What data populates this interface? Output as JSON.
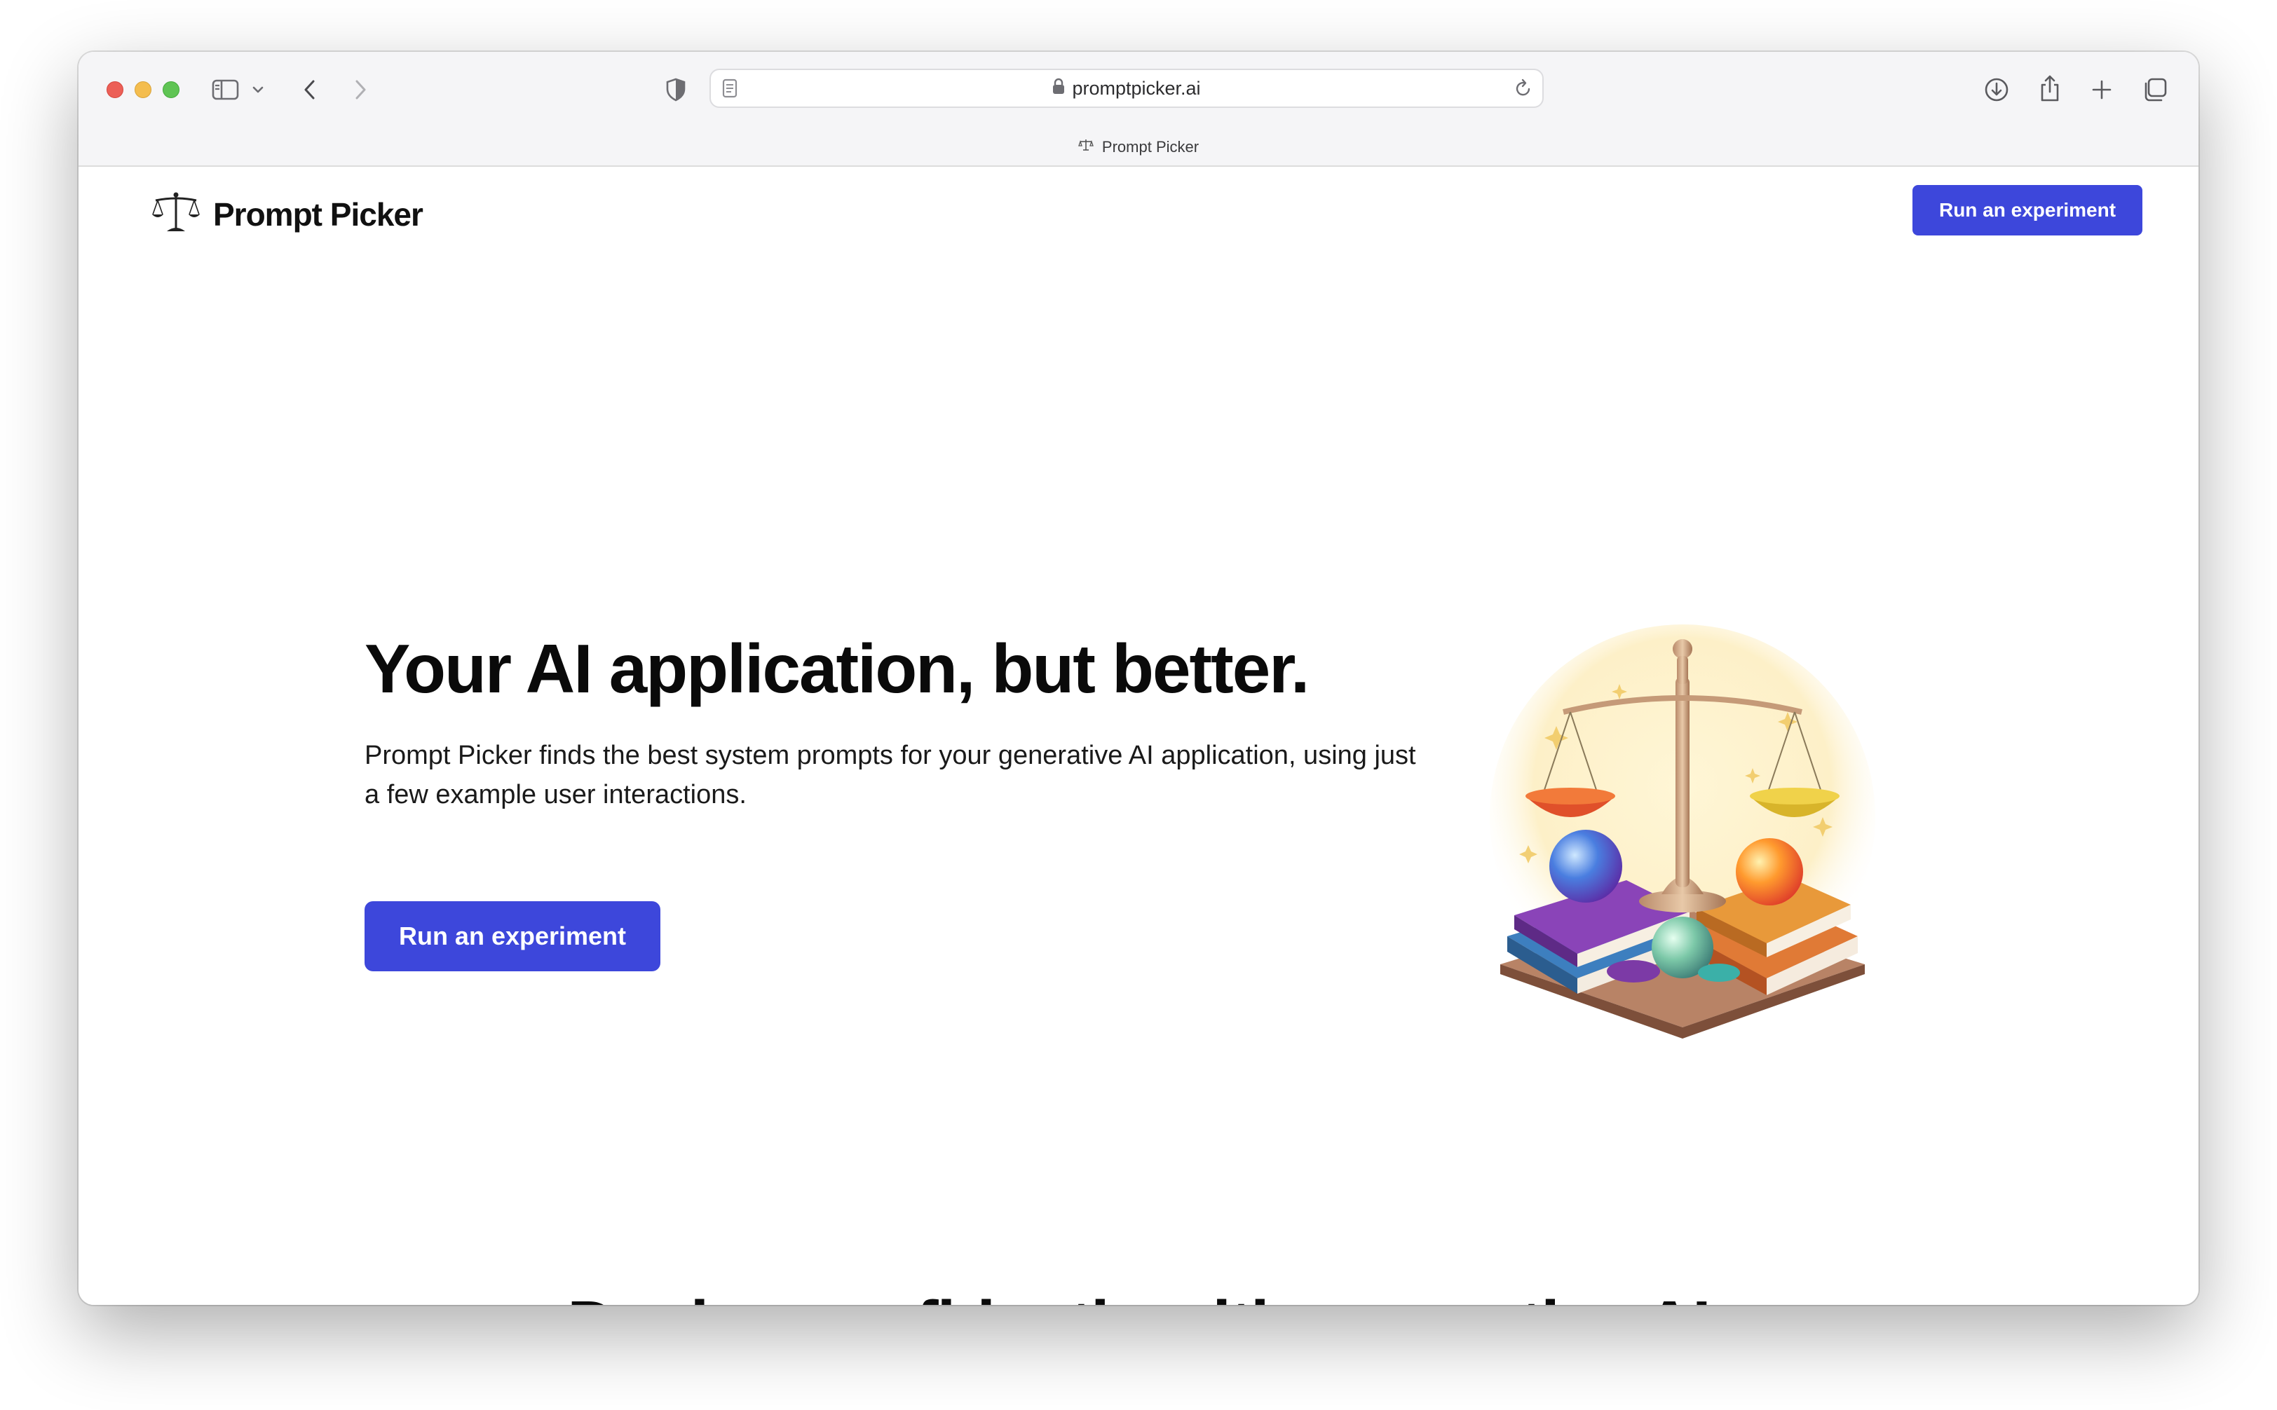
{
  "browser": {
    "url": "promptpicker.ai",
    "tab_title": "Prompt Picker"
  },
  "nav": {
    "brand": "Prompt Picker",
    "cta_label": "Run an experiment"
  },
  "hero": {
    "title": "Your AI application, but better.",
    "subtitle": "Prompt Picker finds the best system prompts for your generative AI application, using just a few example user interactions.",
    "cta_label": "Run an experiment"
  },
  "next_section": {
    "heading_partial": "Deploy confidently with generative AI"
  },
  "colors": {
    "accent": "#3d47db",
    "text": "#0a0a0a",
    "chrome_bg": "#f5f5f7"
  },
  "icons": {
    "logo": "balance-scale-icon",
    "hero_image": "balance-scale-books-orbs-illustration"
  }
}
